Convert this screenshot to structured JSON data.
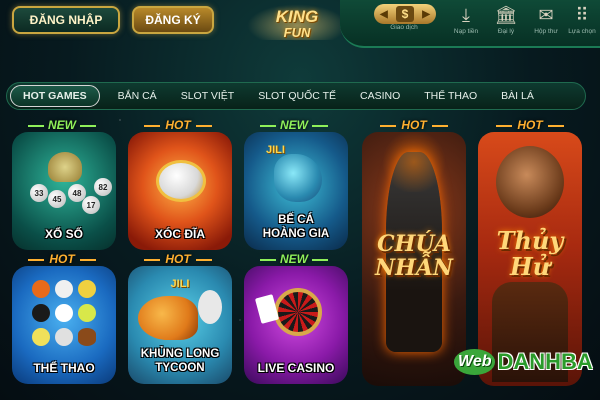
{
  "header": {
    "login_label": "ĐĂNG NHẬP",
    "register_label": "ĐĂNG KÝ",
    "logo_line1": "KING",
    "logo_line2": "FUN",
    "wallet_symbol": "$",
    "nav": [
      {
        "label": "Giao dịch",
        "icon": "transaction-icon"
      },
      {
        "label": "Nạp tiền",
        "icon": "deposit-icon"
      },
      {
        "label": "Đại lý",
        "icon": "agent-icon"
      },
      {
        "label": "Hộp thư",
        "icon": "mailbox-icon"
      },
      {
        "label": "Lựa chọn",
        "icon": "options-icon"
      }
    ]
  },
  "tabs": [
    {
      "label": "HOT GAMES",
      "active": true
    },
    {
      "label": "BẮN CÁ",
      "active": false
    },
    {
      "label": "SLOT VIỆT",
      "active": false
    },
    {
      "label": "SLOT QUỐC TẾ",
      "active": false
    },
    {
      "label": "CASINO",
      "active": false
    },
    {
      "label": "THỂ THAO",
      "active": false
    },
    {
      "label": "BÀI LÁ",
      "active": false
    }
  ],
  "games": {
    "xoso": {
      "badge": "NEW",
      "title": "XỔ SỐ",
      "balls": [
        "33",
        "45",
        "48",
        "17",
        "82"
      ]
    },
    "xocdia": {
      "badge": "HOT",
      "title": "XÓC ĐĨA"
    },
    "beca": {
      "badge": "NEW",
      "provider": "JILI",
      "title_line1": "BẾ CÁ",
      "title_line2": "HOÀNG GIA"
    },
    "chuanhan": {
      "badge": "HOT",
      "title_line1": "CHÚA",
      "title_line2": "NHẪN"
    },
    "thuyhu": {
      "badge": "HOT",
      "title_line1": "Thủy",
      "title_line2": "Hử"
    },
    "thethao": {
      "badge": "HOT",
      "title": "THỂ THAO"
    },
    "khunglong": {
      "badge": "HOT",
      "provider": "JILI",
      "title_line1": "KHỦNG LONG",
      "title_line2": "TYCOON"
    },
    "livecasino": {
      "badge": "NEW",
      "title": "LIVE CASINO"
    }
  },
  "watermark": {
    "part1": "Web",
    "part2": "DANHBA"
  },
  "colors": {
    "gold": "#c9a640",
    "hot": "#ffb030",
    "new": "#8ff05a",
    "panel": "#0f4a37"
  }
}
